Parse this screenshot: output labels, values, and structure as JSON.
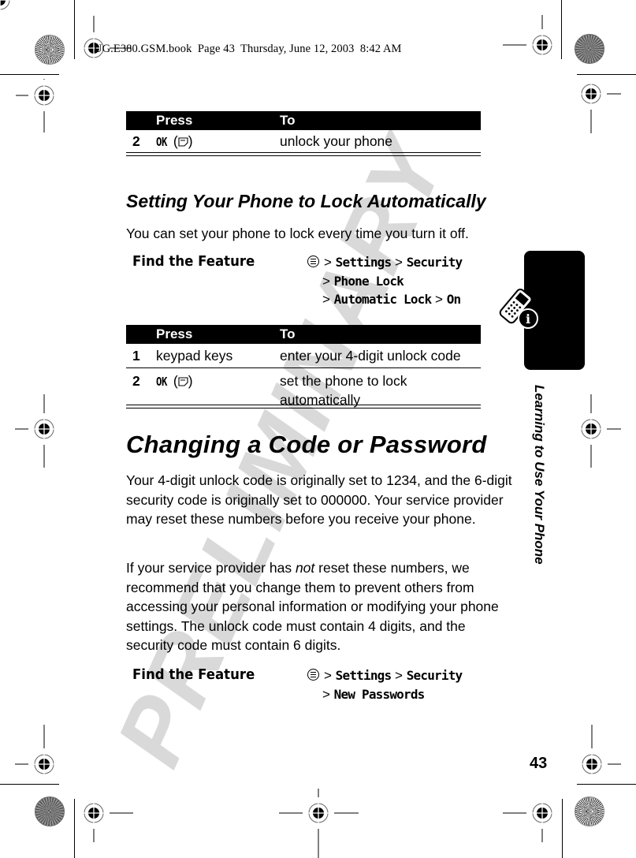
{
  "print_slug": "UG.E380.GSM.book  Page 43  Thursday, June 12, 2003  8:42 AM",
  "watermark": "PRELIMINARY",
  "side_tab": {
    "title": "Learning to Use Your Phone",
    "icon": "phone-info-icon"
  },
  "page_number": "43",
  "top_table": {
    "headers": {
      "press": "Press",
      "to": "To"
    },
    "rows": [
      {
        "num": "2",
        "press_key": "OK",
        "press_icon": "soft-key-icon",
        "to": "unlock your phone"
      }
    ]
  },
  "section_auto_lock": {
    "heading": "Setting Your Phone to Lock Automatically",
    "intro": "You can set your phone to lock every time you turn it off.",
    "find_feature": {
      "label": "Find the Feature",
      "icon": "menu-key-icon",
      "path_lines": [
        [
          "Settings",
          "Security"
        ],
        [
          "Phone Lock"
        ],
        [
          "Automatic Lock",
          "On"
        ]
      ]
    },
    "table": {
      "headers": {
        "press": "Press",
        "to": "To"
      },
      "rows": [
        {
          "num": "1",
          "press": "keypad keys",
          "to": "enter your 4-digit unlock code"
        },
        {
          "num": "2",
          "press_key": "OK",
          "press_icon": "soft-key-icon",
          "to": "set the phone to lock automatically"
        }
      ]
    }
  },
  "section_change_code": {
    "heading": "Changing a Code or Password",
    "para1": "Your 4-digit unlock code is originally set to 1234, and the 6-digit security code is originally set to 000000. Your service provider may reset these numbers before you receive your phone.",
    "para2_before": "If your service provider has ",
    "para2_emph": "not",
    "para2_after": " reset these numbers, we recommend that you change them to prevent others from accessing your personal information or modifying your phone settings. The unlock code must contain 4 digits, and the security code must contain 6 digits.",
    "find_feature": {
      "label": "Find the Feature",
      "icon": "menu-key-icon",
      "path_lines": [
        [
          "Settings",
          "Security"
        ],
        [
          "New Passwords"
        ]
      ]
    }
  }
}
